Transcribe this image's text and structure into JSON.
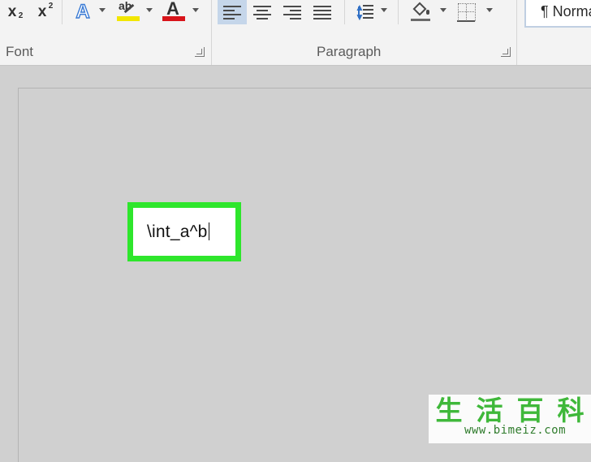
{
  "ribbon": {
    "font_group_label": "Font",
    "paragraph_group_label": "Paragraph",
    "buttons": {
      "subscript": "x",
      "subscript_mark": "2",
      "superscript": "x",
      "superscript_mark": "2",
      "text_effects": "A",
      "highlight": "ab",
      "font_color": "A"
    },
    "style_preview": "¶ Normal"
  },
  "document": {
    "equation_input": "\\int_a^b"
  },
  "watermark": {
    "chars": [
      "生",
      "活",
      "百",
      "科"
    ],
    "url": "www.bimeiz.com"
  },
  "colors": {
    "highlight_yellow": "#f2e600",
    "font_red": "#d8141a",
    "selection_green": "#2ee62c",
    "align_active_bg": "#c5d6ea"
  }
}
